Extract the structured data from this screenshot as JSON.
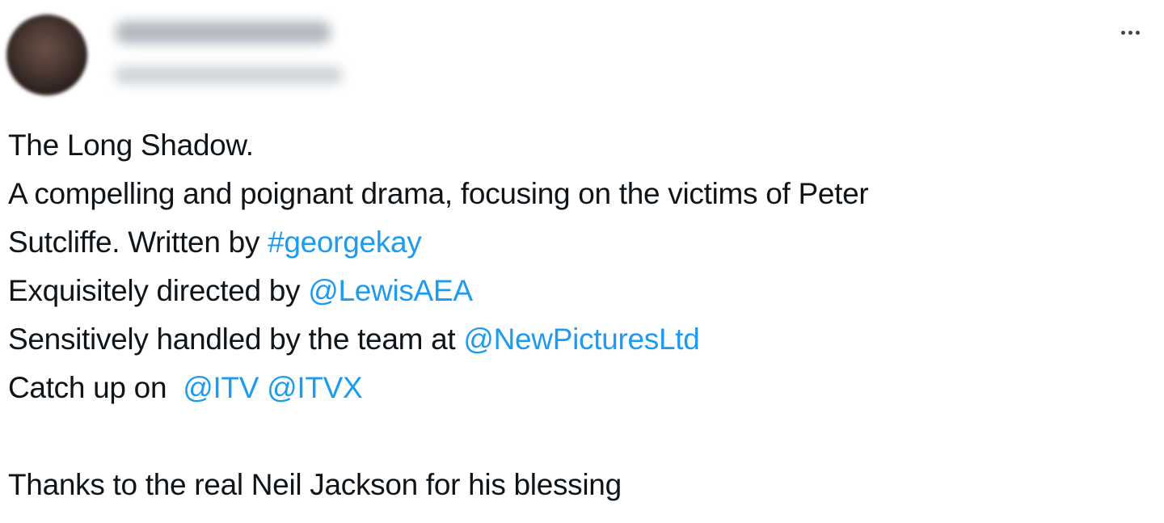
{
  "tweet": {
    "more_label": "More",
    "lines": [
      {
        "text": "The Long Shadow."
      },
      {
        "text": "A compelling and poignant drama, focusing on the victims of Peter"
      },
      {
        "text": "Sutcliffe. Written by ",
        "link": "#georgekay"
      },
      {
        "text": "Exquisitely directed by ",
        "link": "@LewisAEA"
      },
      {
        "text": "Sensitively handled by the team at ",
        "link": "@NewPicturesLtd"
      },
      {
        "text": "Catch up on  ",
        "link": "@ITV",
        "sep": " ",
        "link2": "@ITVX"
      },
      {
        "text": ""
      },
      {
        "text": "Thanks to the real Neil Jackson for his blessing"
      }
    ]
  },
  "colors": {
    "text": "#0f1419",
    "link": "#1d9bf0"
  }
}
